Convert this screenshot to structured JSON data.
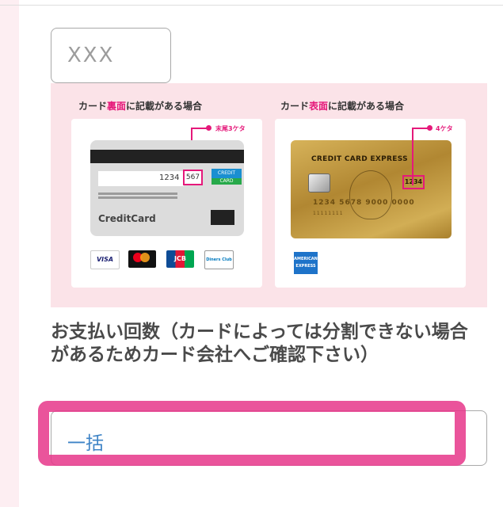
{
  "security_code": {
    "placeholder": "XXX"
  },
  "guide": {
    "back": {
      "title_prefix": "カード",
      "title_highlight": "裏面",
      "title_suffix": "に記載がある場合",
      "callout": "末尾3ケタ",
      "card_number": "1234",
      "cvv": "567",
      "badge_line1": "CREDIT",
      "badge_line2": "CARD",
      "brand": "CreditCard",
      "logos": [
        {
          "name": "VISA",
          "text": "VISA"
        },
        {
          "name": "Mastercard",
          "text": "mastercard"
        },
        {
          "name": "JCB",
          "text": "JCB"
        },
        {
          "name": "Diners Club",
          "text": "Diners Club"
        }
      ]
    },
    "front": {
      "title_prefix": "カード",
      "title_highlight": "表面",
      "title_suffix": "に記載がある場合",
      "callout": "4ケタ",
      "card_title": "CREDIT CARD EXPRESS",
      "code": "1234",
      "card_number": "1234 5678 9000 0000",
      "small_digits": "11111111",
      "amex": "AMERICAN EXPRESS"
    }
  },
  "installments": {
    "label": "お支払い回数（カードによっては分割できない場合があるためカード会社へご確認下さい）",
    "value": "一括"
  },
  "colors": {
    "accent": "#e5197a",
    "select_text": "#3d83c6",
    "guide_bg": "#fbe3e8",
    "page_bg": "#fdeef2"
  }
}
